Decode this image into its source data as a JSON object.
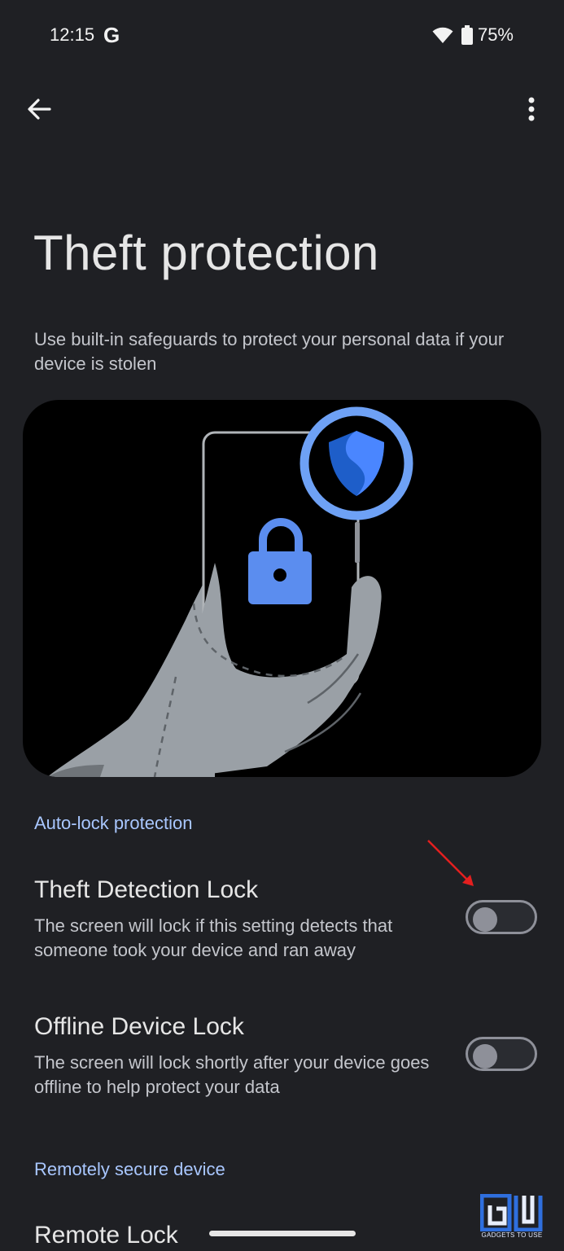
{
  "status_bar": {
    "time": "12:15",
    "g_logo": "G",
    "battery": "75%",
    "icons": [
      "wifi-icon",
      "battery-icon"
    ]
  },
  "app_bar": {
    "back_icon": "arrow-left-icon",
    "menu_icon": "more-vertical-icon"
  },
  "page": {
    "title": "Theft protection",
    "description": "Use built-in safeguards to protect your personal data if your device is stolen"
  },
  "sections": {
    "auto_lock": {
      "header": "Auto-lock protection",
      "settings": [
        {
          "title": "Theft Detection Lock",
          "description": "The screen will lock if this setting detects that someone took your device and ran away",
          "enabled": false
        },
        {
          "title": "Offline Device Lock",
          "description": "The screen will lock shortly after your device goes offline to help protect your data",
          "enabled": false
        }
      ]
    },
    "remote": {
      "header": "Remotely secure device",
      "settings": [
        {
          "title": "Remote Lock"
        }
      ]
    }
  },
  "watermark": {
    "logo": "GU",
    "text": "GADGETS TO USE"
  },
  "colors": {
    "background": "#1f2024",
    "accent": "#a9c7ff",
    "shield_blue": "#1e5ec9",
    "lock_blue": "#5b8def",
    "annotation": "#e41f1f"
  }
}
